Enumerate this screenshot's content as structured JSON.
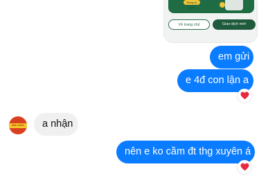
{
  "shared_card": {
    "banner_pill": "Đăng ký ngay",
    "home_button": "Về trang chủ",
    "transaction_button": "Giao dịch mới"
  },
  "messages": [
    {
      "sender": "me",
      "text": "em gửi"
    },
    {
      "sender": "me",
      "text": "e 4đ con lận a",
      "reaction": "heart"
    },
    {
      "sender": "other",
      "text": "a nhận"
    },
    {
      "sender": "me",
      "text": "nên e ko cầm đt thg xuyên á",
      "reaction": "heart"
    }
  ],
  "avatar": {
    "label": "BULLDOG"
  },
  "colors": {
    "my_bubble": "#0a7cff",
    "their_bubble": "#f0f0f0",
    "reaction": "#e8293e",
    "card_green": "#1f5a3c"
  }
}
